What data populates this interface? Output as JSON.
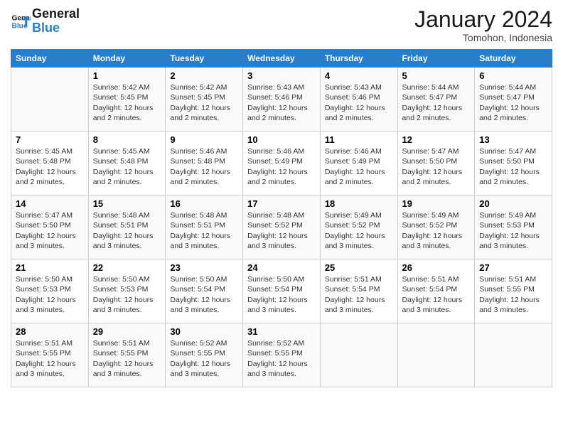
{
  "logo": {
    "text_general": "General",
    "text_blue": "Blue"
  },
  "title": "January 2024",
  "location": "Tomohon, Indonesia",
  "days_of_week": [
    "Sunday",
    "Monday",
    "Tuesday",
    "Wednesday",
    "Thursday",
    "Friday",
    "Saturday"
  ],
  "weeks": [
    [
      {
        "day": "",
        "info": ""
      },
      {
        "day": "1",
        "info": "Sunrise: 5:42 AM\nSunset: 5:45 PM\nDaylight: 12 hours\nand 2 minutes."
      },
      {
        "day": "2",
        "info": "Sunrise: 5:42 AM\nSunset: 5:45 PM\nDaylight: 12 hours\nand 2 minutes."
      },
      {
        "day": "3",
        "info": "Sunrise: 5:43 AM\nSunset: 5:46 PM\nDaylight: 12 hours\nand 2 minutes."
      },
      {
        "day": "4",
        "info": "Sunrise: 5:43 AM\nSunset: 5:46 PM\nDaylight: 12 hours\nand 2 minutes."
      },
      {
        "day": "5",
        "info": "Sunrise: 5:44 AM\nSunset: 5:47 PM\nDaylight: 12 hours\nand 2 minutes."
      },
      {
        "day": "6",
        "info": "Sunrise: 5:44 AM\nSunset: 5:47 PM\nDaylight: 12 hours\nand 2 minutes."
      }
    ],
    [
      {
        "day": "7",
        "info": "Sunrise: 5:45 AM\nSunset: 5:48 PM\nDaylight: 12 hours\nand 2 minutes."
      },
      {
        "day": "8",
        "info": "Sunrise: 5:45 AM\nSunset: 5:48 PM\nDaylight: 12 hours\nand 2 minutes."
      },
      {
        "day": "9",
        "info": "Sunrise: 5:46 AM\nSunset: 5:48 PM\nDaylight: 12 hours\nand 2 minutes."
      },
      {
        "day": "10",
        "info": "Sunrise: 5:46 AM\nSunset: 5:49 PM\nDaylight: 12 hours\nand 2 minutes."
      },
      {
        "day": "11",
        "info": "Sunrise: 5:46 AM\nSunset: 5:49 PM\nDaylight: 12 hours\nand 2 minutes."
      },
      {
        "day": "12",
        "info": "Sunrise: 5:47 AM\nSunset: 5:50 PM\nDaylight: 12 hours\nand 2 minutes."
      },
      {
        "day": "13",
        "info": "Sunrise: 5:47 AM\nSunset: 5:50 PM\nDaylight: 12 hours\nand 2 minutes."
      }
    ],
    [
      {
        "day": "14",
        "info": "Sunrise: 5:47 AM\nSunset: 5:50 PM\nDaylight: 12 hours\nand 3 minutes."
      },
      {
        "day": "15",
        "info": "Sunrise: 5:48 AM\nSunset: 5:51 PM\nDaylight: 12 hours\nand 3 minutes."
      },
      {
        "day": "16",
        "info": "Sunrise: 5:48 AM\nSunset: 5:51 PM\nDaylight: 12 hours\nand 3 minutes."
      },
      {
        "day": "17",
        "info": "Sunrise: 5:48 AM\nSunset: 5:52 PM\nDaylight: 12 hours\nand 3 minutes."
      },
      {
        "day": "18",
        "info": "Sunrise: 5:49 AM\nSunset: 5:52 PM\nDaylight: 12 hours\nand 3 minutes."
      },
      {
        "day": "19",
        "info": "Sunrise: 5:49 AM\nSunset: 5:52 PM\nDaylight: 12 hours\nand 3 minutes."
      },
      {
        "day": "20",
        "info": "Sunrise: 5:49 AM\nSunset: 5:53 PM\nDaylight: 12 hours\nand 3 minutes."
      }
    ],
    [
      {
        "day": "21",
        "info": "Sunrise: 5:50 AM\nSunset: 5:53 PM\nDaylight: 12 hours\nand 3 minutes."
      },
      {
        "day": "22",
        "info": "Sunrise: 5:50 AM\nSunset: 5:53 PM\nDaylight: 12 hours\nand 3 minutes."
      },
      {
        "day": "23",
        "info": "Sunrise: 5:50 AM\nSunset: 5:54 PM\nDaylight: 12 hours\nand 3 minutes."
      },
      {
        "day": "24",
        "info": "Sunrise: 5:50 AM\nSunset: 5:54 PM\nDaylight: 12 hours\nand 3 minutes."
      },
      {
        "day": "25",
        "info": "Sunrise: 5:51 AM\nSunset: 5:54 PM\nDaylight: 12 hours\nand 3 minutes."
      },
      {
        "day": "26",
        "info": "Sunrise: 5:51 AM\nSunset: 5:54 PM\nDaylight: 12 hours\nand 3 minutes."
      },
      {
        "day": "27",
        "info": "Sunrise: 5:51 AM\nSunset: 5:55 PM\nDaylight: 12 hours\nand 3 minutes."
      }
    ],
    [
      {
        "day": "28",
        "info": "Sunrise: 5:51 AM\nSunset: 5:55 PM\nDaylight: 12 hours\nand 3 minutes."
      },
      {
        "day": "29",
        "info": "Sunrise: 5:51 AM\nSunset: 5:55 PM\nDaylight: 12 hours\nand 3 minutes."
      },
      {
        "day": "30",
        "info": "Sunrise: 5:52 AM\nSunset: 5:55 PM\nDaylight: 12 hours\nand 3 minutes."
      },
      {
        "day": "31",
        "info": "Sunrise: 5:52 AM\nSunset: 5:55 PM\nDaylight: 12 hours\nand 3 minutes."
      },
      {
        "day": "",
        "info": ""
      },
      {
        "day": "",
        "info": ""
      },
      {
        "day": "",
        "info": ""
      }
    ]
  ]
}
